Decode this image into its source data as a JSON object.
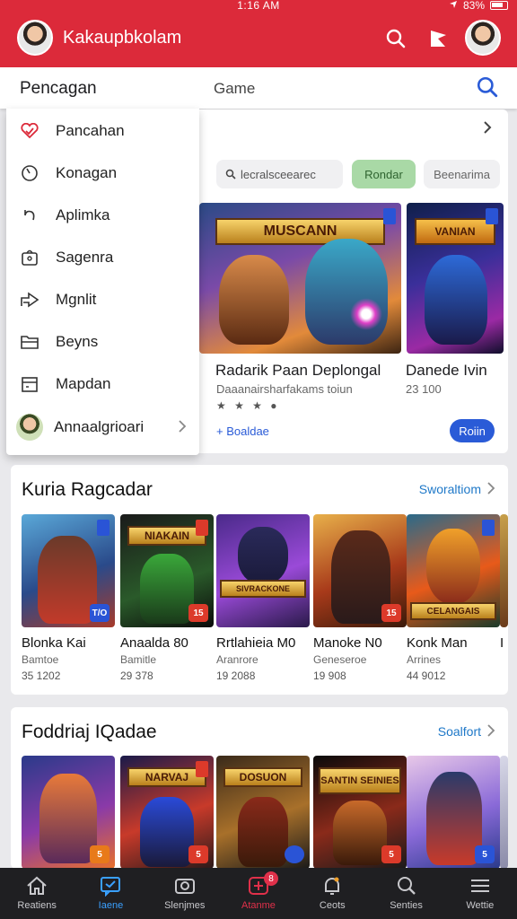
{
  "status": {
    "time": "1:16 AM",
    "battery": "83%"
  },
  "appbar": {
    "title": "Kakaupbkolam"
  },
  "search": {
    "tab_title": "Pencagan",
    "query": "Game"
  },
  "menu": {
    "items": [
      {
        "label": "Pancahan",
        "icon": "heart-check-icon"
      },
      {
        "label": "Konagan",
        "icon": "clock-icon"
      },
      {
        "label": "Aplimka",
        "icon": "undo-arrow-icon"
      },
      {
        "label": "Sagenra",
        "icon": "bag-icon"
      },
      {
        "label": "Mgnlit",
        "icon": "share-icon"
      },
      {
        "label": "Beyns",
        "icon": "folder-icon"
      },
      {
        "label": "Mapdan",
        "icon": "calendar-icon"
      }
    ],
    "profile_label": "Annaalgrioari"
  },
  "featured": {
    "chips": {
      "search_placeholder": "lecralsceearec",
      "active": "Rondar",
      "other": "Beenarima"
    },
    "main": {
      "title": "Radarik Paan Deplongal",
      "subtitle": "Daaanairsharfakams toiun",
      "art_banner": "MUSCANN",
      "stars": "★ ★ ★ ●",
      "link": "+ Boaldae"
    },
    "side": {
      "title": "Danede Ivin",
      "number": "23 100",
      "art_banner": "VANIAN",
      "button": "Roiin"
    }
  },
  "section1": {
    "title": "Kuria Ragcadar",
    "link": "Sworaltiom",
    "tiles": [
      {
        "name": "Blonka Kai",
        "sub": "Bamtoe",
        "num": "35 1202",
        "badge": "T/O"
      },
      {
        "name": "Anaalda 80",
        "sub": "Bamitle",
        "num": "29 378",
        "banner": "NIAKAIN",
        "badge": "15"
      },
      {
        "name": "Rrtlahieia M0",
        "sub": "Aranrore",
        "num": "19 2088",
        "banner": "SIVRACKONE"
      },
      {
        "name": "Manoke N0",
        "sub": "Geneseroe",
        "num": "19 908",
        "badge": "15"
      },
      {
        "name": "Konk Man",
        "sub": "Arrines",
        "num": "44 9012",
        "banner": "CELANGAIS"
      },
      {
        "name": "I",
        "sub": "",
        "num": ""
      }
    ]
  },
  "section2": {
    "title": "Foddriaj IQadae",
    "link": "Soalfort",
    "tiles": [
      {
        "badge": "5"
      },
      {
        "banner": "NARVAJ",
        "badge": "5"
      },
      {
        "banner": "DOSUON"
      },
      {
        "banner": "SANTIN SEINIES",
        "badge": "5"
      },
      {
        "badge": "5"
      }
    ]
  },
  "nav": {
    "items": [
      {
        "label": "Reatiens",
        "icon": "home-icon"
      },
      {
        "label": "Iaene",
        "icon": "chat-icon"
      },
      {
        "label": "Slenjmes",
        "icon": "camera-icon"
      },
      {
        "label": "Atanme",
        "icon": "plus-icon",
        "badge": "8"
      },
      {
        "label": "Ceots",
        "icon": "bell-icon"
      },
      {
        "label": "Senties",
        "icon": "search-icon"
      },
      {
        "label": "Wettie",
        "icon": "menu-icon"
      }
    ]
  },
  "colors": {
    "brand_red": "#dc2a3a",
    "accent_blue": "#2a5bd7",
    "chip_green": "#a9d9a6",
    "nav_bg": "#1f1f22"
  }
}
